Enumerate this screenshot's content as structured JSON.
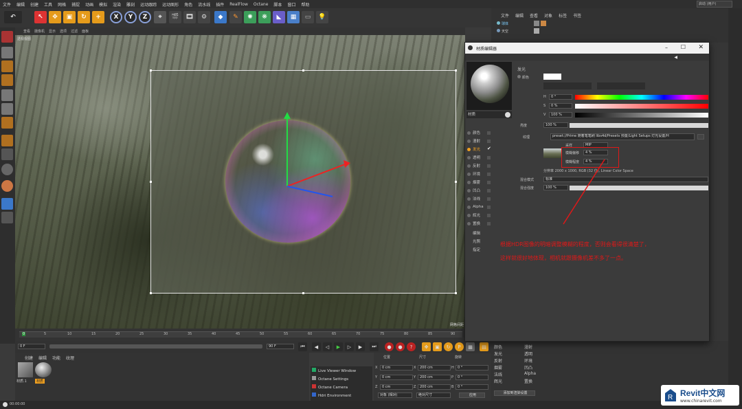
{
  "menubar": {
    "items": [
      "文件",
      "编辑",
      "创建",
      "工具",
      "网格",
      "捕捉",
      "动画",
      "模拟",
      "渲染",
      "雕刻",
      "运动跟踪",
      "运动图形",
      "角色",
      "流水线",
      "插件",
      "RealFlow",
      "Octane",
      "脚本",
      "窗口",
      "帮助"
    ],
    "layout_value": "启动 (用户)"
  },
  "toolbar": {
    "axis_x": "X",
    "axis_y": "Y",
    "axis_z": "Z"
  },
  "viewport": {
    "menu": [
      "查看",
      "摄像机",
      "显示",
      "选项",
      "过滤",
      "面板"
    ],
    "title": "透视视图",
    "corner": "网格间距"
  },
  "timeline": {
    "ticks": [
      "0",
      "5",
      "10",
      "15",
      "20",
      "25",
      "30",
      "35",
      "40",
      "45",
      "50",
      "55",
      "60",
      "65",
      "70",
      "75",
      "80",
      "85",
      "90"
    ],
    "current_frame": "0 F",
    "end_frame": "90 F",
    "start_field": "0 F",
    "end_field": "90 F"
  },
  "material_manager": {
    "menu": [
      "创建",
      "编辑",
      "功能",
      "纹理"
    ],
    "materials": [
      {
        "label": "材质.1",
        "selected": false
      },
      {
        "label": "材质",
        "selected": true
      }
    ]
  },
  "octane_menu": [
    "Live Viewer Window",
    "Octane Settings",
    "Octane Camera",
    "Hdri Environment"
  ],
  "coords": {
    "headers": [
      "位置",
      "尺寸",
      "旋转"
    ],
    "rows": [
      {
        "axis": "X",
        "pos": "0 cm",
        "size": "200 cm",
        "rot_axis": "H",
        "rot": "0 °"
      },
      {
        "axis": "Y",
        "pos": "0 cm",
        "size": "200 cm",
        "rot_axis": "P",
        "rot": "0 °"
      },
      {
        "axis": "Z",
        "pos": "0 cm",
        "size": "200 cm",
        "rot_axis": "B",
        "rot": "0 °"
      }
    ],
    "mode1": "对象 (相对)",
    "mode2": "绝对尺寸",
    "apply": "应用"
  },
  "object_manager": {
    "menu": [
      "文件",
      "编辑",
      "查看",
      "对象",
      "标签",
      "书签"
    ],
    "objects": [
      "球体",
      "天空"
    ]
  },
  "material_editor": {
    "title": "材质编辑器",
    "preview_label": "材质",
    "channels": [
      {
        "name": "颜色",
        "checked": false
      },
      {
        "name": "漫射",
        "checked": false
      },
      {
        "name": "发光",
        "checked": true
      },
      {
        "name": "透明",
        "checked": false
      },
      {
        "name": "反射",
        "checked": false
      },
      {
        "name": "环境",
        "checked": false
      },
      {
        "name": "烟雾",
        "checked": false
      },
      {
        "name": "凹凸",
        "checked": false
      },
      {
        "name": "法线",
        "checked": false
      },
      {
        "name": "Alpha",
        "checked": false
      },
      {
        "name": "辉光",
        "checked": false
      },
      {
        "name": "置换",
        "checked": false
      }
    ],
    "extra_items": [
      "编辑",
      "光照",
      "指定"
    ],
    "section": "发光",
    "color_label": "颜色",
    "h_label": "H",
    "h_value": "0 °",
    "s_label": "S",
    "s_value": "0 %",
    "v_label": "V",
    "v_value": "100 %",
    "brightness_label": "亮度",
    "brightness_value": "100 %",
    "texture_label": "纹理",
    "texture_path": "preset://Prime 随着笔笔刷 libs4d/Presets 预置/Light Setups 灯光设置/H",
    "sampling_label": "采样",
    "sampling_value": "MIP",
    "blur_offset_label": "模糊偏移",
    "blur_offset_value": "4 %",
    "blur_scale_label": "模糊程度",
    "blur_scale_value": "4 %",
    "resolution": "分辨率 2000 x 1000, RGB (32 位), Linear Color Space",
    "mix_mode_label": "混合模式",
    "mix_mode_value": "标准",
    "mix_strength_label": "混合强度",
    "mix_strength_value": "100 %"
  },
  "attr_lower": {
    "channels_col1": [
      "颜色",
      "发光",
      "反射",
      "烟雾",
      "法线",
      "辉光"
    ],
    "channels_col2": [
      "漫射",
      "透明",
      "环境",
      "凹凸",
      "Alpha",
      "置换"
    ],
    "add_button": "添加到渲染设置"
  },
  "status": {
    "time": "00:00:00"
  },
  "annotation": {
    "line1": "根据HDR图像的明暗调整模糊的程度，否则会看得很清楚了，",
    "line2": "这样就很好地体现，相机就跟摄像机差不多了一点。"
  },
  "watermark": {
    "brand": "Revit中文网",
    "url": "www.chinarevit.com"
  },
  "colors": {
    "accent_orange": "#f0a020",
    "annotation_red": "#e01818",
    "bg_dark": "#3a3a3a"
  }
}
